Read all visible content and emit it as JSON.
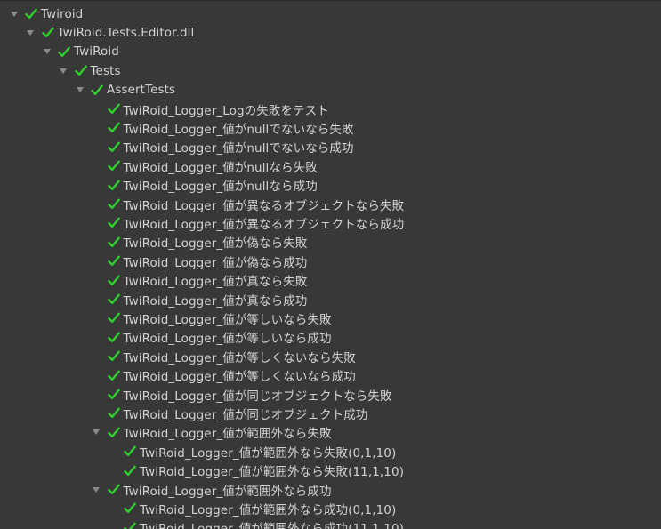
{
  "colors": {
    "background": "#383838",
    "text": "#d2d2d2",
    "pass_check": "#2fd12f",
    "arrow": "#8a8a8a"
  },
  "icons": {
    "expand": "triangle-down-icon",
    "status": "checkmark-icon"
  },
  "tree": [
    {
      "label": "Twiroid",
      "depth": 0,
      "expanded": true,
      "status": "passed"
    },
    {
      "label": "TwiRoid.Tests.Editor.dll",
      "depth": 1,
      "expanded": true,
      "status": "passed"
    },
    {
      "label": "TwiRoid",
      "depth": 2,
      "expanded": true,
      "status": "passed"
    },
    {
      "label": "Tests",
      "depth": 3,
      "expanded": true,
      "status": "passed"
    },
    {
      "label": "AssertTests",
      "depth": 4,
      "expanded": true,
      "status": "passed"
    },
    {
      "label": "TwiRoid_Logger_Logの失敗をテスト",
      "depth": 5,
      "expanded": null,
      "status": "passed"
    },
    {
      "label": "TwiRoid_Logger_値がnullでないなら失敗",
      "depth": 5,
      "expanded": null,
      "status": "passed"
    },
    {
      "label": "TwiRoid_Logger_値がnullでないなら成功",
      "depth": 5,
      "expanded": null,
      "status": "passed"
    },
    {
      "label": "TwiRoid_Logger_値がnullなら失敗",
      "depth": 5,
      "expanded": null,
      "status": "passed"
    },
    {
      "label": "TwiRoid_Logger_値がnullなら成功",
      "depth": 5,
      "expanded": null,
      "status": "passed"
    },
    {
      "label": "TwiRoid_Logger_値が異なるオブジェクトなら失敗",
      "depth": 5,
      "expanded": null,
      "status": "passed"
    },
    {
      "label": "TwiRoid_Logger_値が異なるオブジェクトなら成功",
      "depth": 5,
      "expanded": null,
      "status": "passed"
    },
    {
      "label": "TwiRoid_Logger_値が偽なら失敗",
      "depth": 5,
      "expanded": null,
      "status": "passed"
    },
    {
      "label": "TwiRoid_Logger_値が偽なら成功",
      "depth": 5,
      "expanded": null,
      "status": "passed"
    },
    {
      "label": "TwiRoid_Logger_値が真なら失敗",
      "depth": 5,
      "expanded": null,
      "status": "passed"
    },
    {
      "label": "TwiRoid_Logger_値が真なら成功",
      "depth": 5,
      "expanded": null,
      "status": "passed"
    },
    {
      "label": "TwiRoid_Logger_値が等しいなら失敗",
      "depth": 5,
      "expanded": null,
      "status": "passed"
    },
    {
      "label": "TwiRoid_Logger_値が等しいなら成功",
      "depth": 5,
      "expanded": null,
      "status": "passed"
    },
    {
      "label": "TwiRoid_Logger_値が等しくないなら失敗",
      "depth": 5,
      "expanded": null,
      "status": "passed"
    },
    {
      "label": "TwiRoid_Logger_値が等しくないなら成功",
      "depth": 5,
      "expanded": null,
      "status": "passed"
    },
    {
      "label": "TwiRoid_Logger_値が同じオブジェクトなら失敗",
      "depth": 5,
      "expanded": null,
      "status": "passed"
    },
    {
      "label": "TwiRoid_Logger_値が同じオブジェクト成功",
      "depth": 5,
      "expanded": null,
      "status": "passed"
    },
    {
      "label": "TwiRoid_Logger_値が範囲外なら失敗",
      "depth": 5,
      "expanded": true,
      "status": "passed"
    },
    {
      "label": "TwiRoid_Logger_値が範囲外なら失敗(0,1,10)",
      "depth": 6,
      "expanded": null,
      "status": "passed"
    },
    {
      "label": "TwiRoid_Logger_値が範囲外なら失敗(11,1,10)",
      "depth": 6,
      "expanded": null,
      "status": "passed"
    },
    {
      "label": "TwiRoid_Logger_値が範囲外なら成功",
      "depth": 5,
      "expanded": true,
      "status": "passed"
    },
    {
      "label": "TwiRoid_Logger_値が範囲外なら成功(0,1,10)",
      "depth": 6,
      "expanded": null,
      "status": "passed"
    },
    {
      "label": "TwiRoid_Logger_値が範囲外なら成功(11,1,10)",
      "depth": 6,
      "expanded": null,
      "status": "passed"
    }
  ]
}
